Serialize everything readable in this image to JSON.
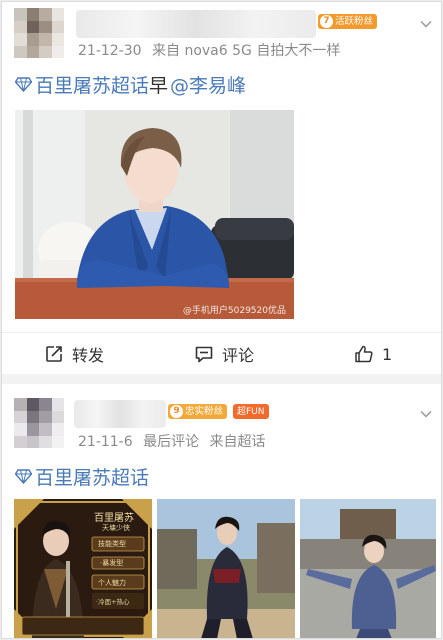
{
  "posts": [
    {
      "badge": "活跃粉丝",
      "meta": {
        "time": "21-12-30",
        "source": "来自 nova6 5G 自拍大不一样"
      },
      "topic": {
        "name": "百里屠苏超话",
        "text": "早",
        "mention": "@李易峰"
      },
      "photo_watermark": "@手机用户5029520优品",
      "actions": {
        "repost": "转发",
        "comment": "评论",
        "like_count": "1"
      }
    },
    {
      "badges": {
        "loyal": "忠实粉丝",
        "fun": "超FUN"
      },
      "meta": {
        "time": "21-11-6",
        "last": "最后评论",
        "source": "来自超话"
      },
      "topic": {
        "name": "百里屠苏超话"
      },
      "thumb1": {
        "title": "百里屠苏",
        "subtitle": "天墉少侠",
        "tags": [
          "技能类型",
          "·暴发型",
          "个人魅力",
          "·冷面+热心"
        ]
      }
    }
  ],
  "colors": {
    "link": "#4a7ab8",
    "badge_orange": "#f39a2c",
    "badge_fun": "#f26a2c"
  },
  "icons": [
    "diamond-icon",
    "repost-icon",
    "comment-icon",
    "like-icon",
    "chevron-down-icon"
  ]
}
